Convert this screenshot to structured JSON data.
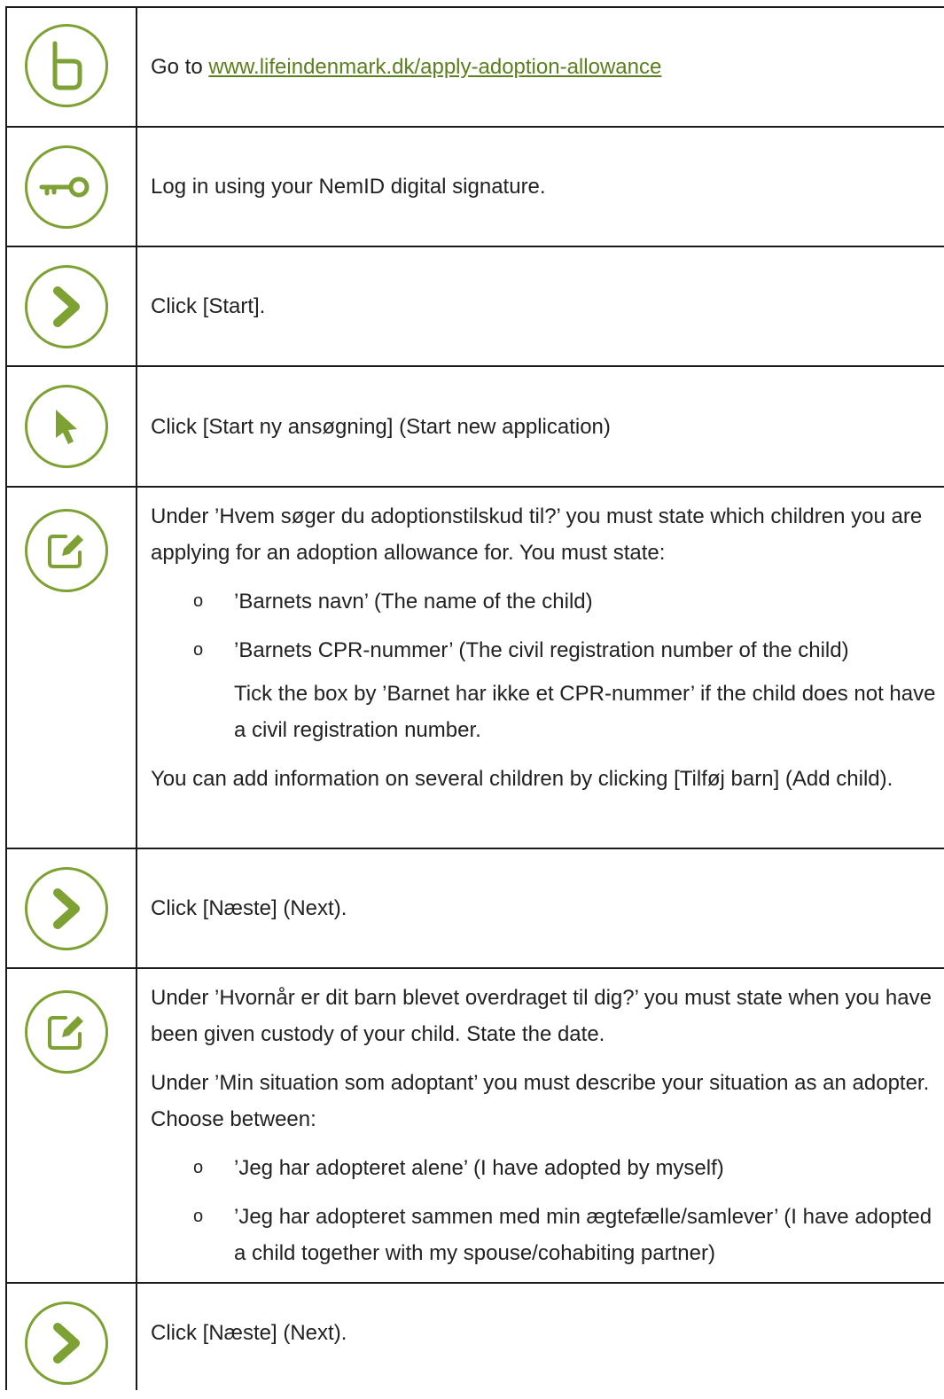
{
  "steps": [
    {
      "icon": "website-b-icon",
      "prefix": "Go to ",
      "link": "www.lifeindenmark.dk/apply-adoption-allowance"
    },
    {
      "icon": "key-icon",
      "text": "Log in using your NemID digital signature."
    },
    {
      "icon": "chevron-right-icon",
      "text": "Click [Start]."
    },
    {
      "icon": "cursor-icon",
      "text": "Click [Start ny ansøgning] (Start new application)"
    },
    {
      "icon": "edit-icon",
      "intro": "Under ’Hvem søger du adoptionstilskud til?’ you must state which children you are applying for an adoption allowance for. You must state:",
      "bullets": [
        "’Barnets navn’ (The name of the child)",
        "’Barnets CPR-nummer’ (The civil registration number of the child)"
      ],
      "note": "Tick the box by ’Barnet har ikke et CPR-nummer’ if the child does not have a civil registration number.",
      "outro": "You can add information on several children by clicking [Tilføj barn] (Add child)."
    },
    {
      "icon": "chevron-right-icon",
      "text": "Click [Næste] (Next)."
    },
    {
      "icon": "edit-icon",
      "intro": "Under ’Hvornår er dit barn blevet overdraget til dig?’ you must state when you have been given custody of your child. State the date.",
      "para2": "Under ’Min situation som adoptant’ you must describe your situation as an adopter. Choose between:",
      "bullets": [
        "’Jeg har adopteret alene’ (I have adopted by myself)",
        "’Jeg har adopteret sammen med min ægtefælle/samlever’ (I have adopted a child together with my spouse/cohabiting partner)"
      ]
    },
    {
      "icon": "chevron-right-icon",
      "text": "Click [Næste] (Next)."
    }
  ],
  "bullet_glyph": "o",
  "colors": {
    "accent": "#7da133",
    "link": "#5b7f1d",
    "border": "#1a1a1a"
  }
}
